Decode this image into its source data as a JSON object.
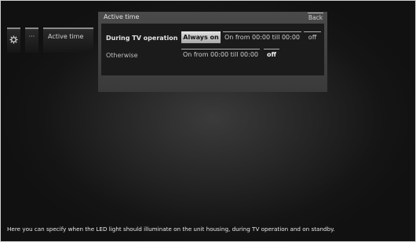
{
  "breadcrumb": {
    "gear_icon": "gear-icon",
    "ellipsis": "···",
    "active": "Active time"
  },
  "panel": {
    "title": "Active time",
    "back_label": "Back",
    "rows": [
      {
        "label": "During TV operation",
        "options": [
          {
            "label": "Always on",
            "selected": true
          },
          {
            "label": "On from 00:00 till 00:00",
            "selected": false
          },
          {
            "label": "off",
            "selected": false
          }
        ]
      },
      {
        "label": "Otherwise",
        "options": [
          {
            "label": "On from 00:00 till 00:00",
            "selected": false
          },
          {
            "label": "off",
            "selected": true
          }
        ]
      }
    ]
  },
  "help_text": "Here you can specify when the LED light should illuminate on the unit housing, during TV operation and on standby.",
  "colors": {
    "background": "#1e1e1e",
    "panel": "#454545",
    "selected": "#c8c8c8"
  }
}
